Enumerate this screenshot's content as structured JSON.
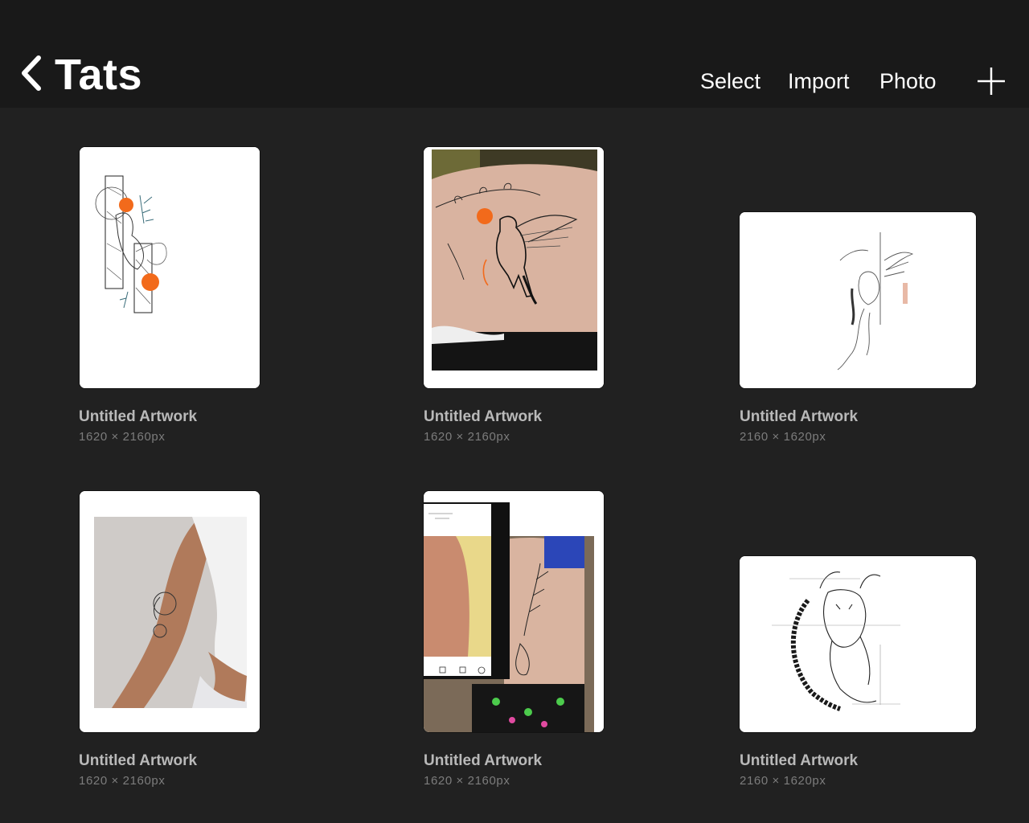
{
  "header": {
    "title": "Tats",
    "select_label": "Select",
    "import_label": "Import",
    "photo_label": "Photo"
  },
  "artworks": [
    {
      "name": "Untitled Artwork",
      "size": "1620 × 2160px",
      "image": "fox-tattoo-sketch"
    },
    {
      "name": "Untitled Artwork",
      "size": "1620 × 2160px",
      "image": "pegasus-shoulder-tattoo-photo"
    },
    {
      "name": "Untitled Artwork",
      "size": "2160 × 1620px",
      "image": "winged-sketch-drawing"
    },
    {
      "name": "Untitled Artwork",
      "size": "1620 × 2160px",
      "image": "arm-tattoo-photo"
    },
    {
      "name": "Untitled Artwork",
      "size": "1620 × 2160px",
      "image": "back-tattoo-collage-photo"
    },
    {
      "name": "Untitled Artwork",
      "size": "2160 × 1620px",
      "image": "deer-tattoo-sketch"
    }
  ],
  "colors": {
    "background": "#212121",
    "topbar": "#191919",
    "accent_orange": "#f26a1b",
    "title_text": "#b9b9b9",
    "meta_text": "#7c7c7c"
  }
}
